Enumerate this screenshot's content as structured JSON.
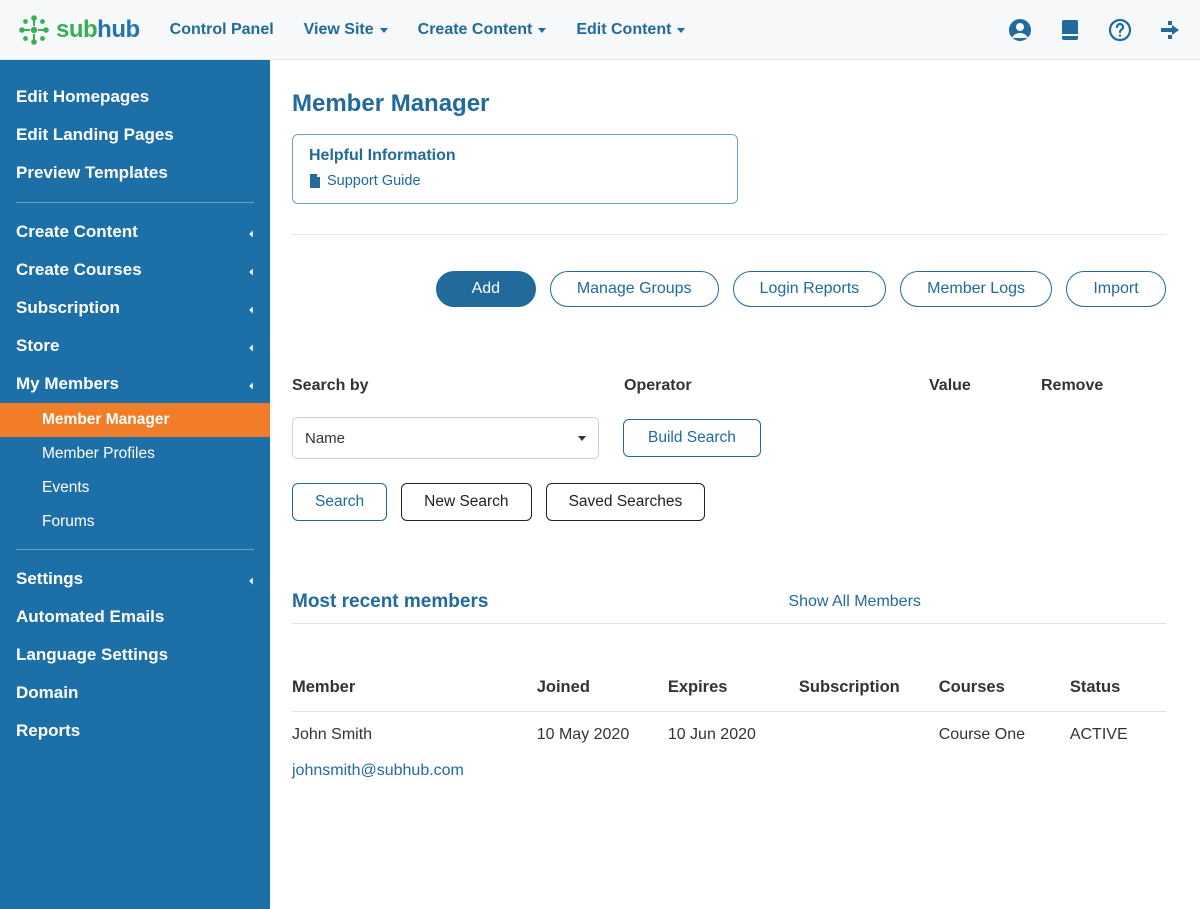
{
  "logo": {
    "text_a": "sub",
    "text_b": "hub"
  },
  "topnav": {
    "control_panel": "Control Panel",
    "view_site": "View Site",
    "create_content": "Create Content",
    "edit_content": "Edit Content"
  },
  "sidebar": {
    "edit_homepages": "Edit Homepages",
    "edit_landing_pages": "Edit Landing Pages",
    "preview_templates": "Preview Templates",
    "create_content": "Create Content",
    "create_courses": "Create Courses",
    "subscription": "Subscription",
    "store": "Store",
    "my_members": "My Members",
    "sub_member_manager": "Member Manager",
    "sub_member_profiles": "Member Profiles",
    "sub_events": "Events",
    "sub_forums": "Forums",
    "settings": "Settings",
    "automated_emails": "Automated Emails",
    "language_settings": "Language Settings",
    "domain": "Domain",
    "reports": "Reports"
  },
  "page": {
    "title": "Member Manager",
    "info_title": "Helpful Information",
    "support_guide": "Support Guide"
  },
  "actions": {
    "add": "Add",
    "manage_groups": "Manage Groups",
    "login_reports": "Login Reports",
    "member_logs": "Member Logs",
    "import": "Import"
  },
  "search": {
    "header_searchby": "Search by",
    "header_operator": "Operator",
    "header_value": "Value",
    "header_remove": "Remove",
    "select_value": "Name",
    "build_search": "Build Search",
    "search_btn": "Search",
    "new_search": "New Search",
    "saved_searches": "Saved Searches"
  },
  "recent": {
    "title": "Most recent members",
    "show_all": "Show All Members"
  },
  "table": {
    "headers": {
      "member": "Member",
      "joined": "Joined",
      "expires": "Expires",
      "subscription": "Subscription",
      "courses": "Courses",
      "status": "Status"
    },
    "rows": [
      {
        "name": "John Smith",
        "email": "johnsmith@subhub.com",
        "joined": "10 May 2020",
        "expires": "10 Jun 2020",
        "subscription": "",
        "courses": "Course One",
        "status": "ACTIVE"
      }
    ]
  }
}
